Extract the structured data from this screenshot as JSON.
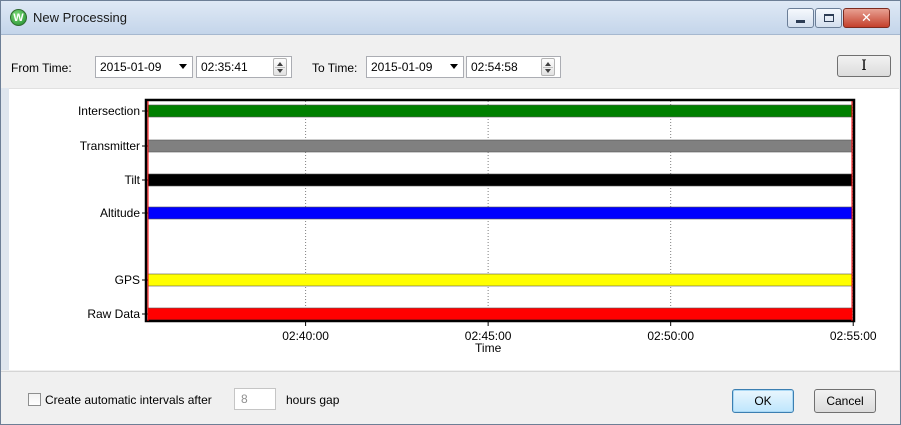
{
  "window": {
    "title": "New Processing",
    "icon": "app-w-icon",
    "controls": [
      "minimize",
      "maximize",
      "close"
    ]
  },
  "toolbar": {
    "from_label": "From Time:",
    "from_date": "2015-01-09",
    "from_time": "02:35:41",
    "to_label": "To Time:",
    "to_date": "2015-01-09",
    "to_time": "02:54:58",
    "cursor_button_label": "I"
  },
  "chart_data": {
    "type": "bar",
    "orientation": "horizontal",
    "x_range": [
      "02:35:41",
      "02:54:58"
    ],
    "x_ticks": [
      "02:40:00",
      "02:45:00",
      "02:50:00",
      "02:55:00"
    ],
    "xlabel": "Time",
    "grid": "vertical dotted",
    "series": [
      {
        "name": "Intersection",
        "start": "02:35:41",
        "end": "02:54:58",
        "color": "#008000"
      },
      {
        "name": "Transmitter",
        "start": "02:35:41",
        "end": "02:54:58",
        "color": "#808080"
      },
      {
        "name": "Tilt",
        "start": "02:35:41",
        "end": "02:54:58",
        "color": "#000000"
      },
      {
        "name": "Altitude",
        "start": "02:35:41",
        "end": "02:54:58",
        "color": "#0000ff"
      },
      {
        "name": "GPS",
        "start": "02:35:41",
        "end": "02:54:58",
        "color": "#ffff00"
      },
      {
        "name": "Raw Data",
        "start": "02:35:41",
        "end": "02:54:58",
        "color": "#ff0000"
      }
    ],
    "selection_marker_color": "#ff0000"
  },
  "bottom": {
    "auto_checkbox_label": "Create automatic intervals after",
    "auto_checkbox_checked": false,
    "hours_value": "8",
    "hours_suffix": "hours gap",
    "ok_label": "OK",
    "cancel_label": "Cancel"
  }
}
